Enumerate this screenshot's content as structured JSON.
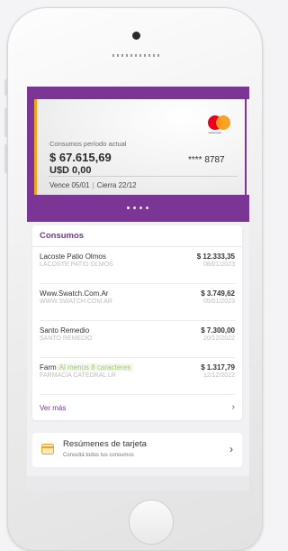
{
  "card": {
    "period_label": "Consumos período actual",
    "amount_ars": "$ 67.615,69",
    "amount_usd": "U$D 0,00",
    "last4": "**** 8787",
    "vence": "Vence 05/01",
    "cierra": "Cierra 22/12",
    "brand": "mastercard",
    "accent_color": "#f1a51d"
  },
  "colors": {
    "primary": "#7a3595"
  },
  "carousel": {
    "dots": 4,
    "active_index": 0
  },
  "consumos": {
    "title": "Consumos",
    "rows": [
      {
        "name": "Lacoste Patio Olmos",
        "sub": "LACOSTE PATIO OLMOS",
        "amount": "$ 12.333,35",
        "date": "08/01/2023"
      },
      {
        "name": "Www.Swatch.Com.Ar",
        "sub": "WWW.SWATCH.COM.AR",
        "amount": "$ 3.749,62",
        "date": "05/01/2023"
      },
      {
        "name": "Santo Remedio",
        "sub": "SANTO REMEDIO",
        "amount": "$ 7.300,00",
        "date": "20/12/2022"
      },
      {
        "name": "Farm",
        "hint": "Al menos 8 caracteres",
        "sub": "FARMACIA CATEDRAL LR",
        "amount": "$ 1.317,79",
        "date": "12/12/2022"
      }
    ],
    "ver_mas": "Ver más"
  },
  "resumenes": {
    "title": "Resúmenes de tarjeta",
    "subtitle": "Consultá todos tus consumos"
  }
}
